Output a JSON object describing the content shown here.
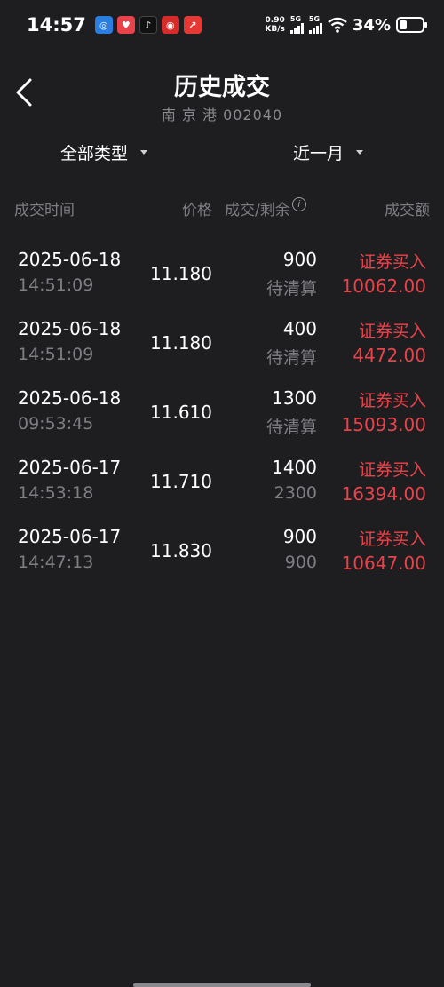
{
  "status_bar": {
    "time": "14:57",
    "net_speed_value": "0.90",
    "net_speed_unit": "KB/s",
    "signal1_label": "5G",
    "signal2_label": "5G",
    "battery": "34%",
    "battery_level": 0.34
  },
  "header": {
    "title": "历史成交",
    "subtitle": "南 京 港 002040"
  },
  "filters": {
    "type": "全部类型",
    "period": "近一月"
  },
  "columns": {
    "time": "成交时间",
    "price": "价格",
    "fill": "成交/剩余",
    "amount": "成交额"
  },
  "trades": [
    {
      "date": "2025-06-18",
      "time": "14:51:09",
      "price": "11.180",
      "qty": "900",
      "remaining": "待清算",
      "type": "证券买入",
      "amount": "10062.00"
    },
    {
      "date": "2025-06-18",
      "time": "14:51:09",
      "price": "11.180",
      "qty": "400",
      "remaining": "待清算",
      "type": "证券买入",
      "amount": "4472.00"
    },
    {
      "date": "2025-06-18",
      "time": "09:53:45",
      "price": "11.610",
      "qty": "1300",
      "remaining": "待清算",
      "type": "证券买入",
      "amount": "15093.00"
    },
    {
      "date": "2025-06-17",
      "time": "14:53:18",
      "price": "11.710",
      "qty": "1400",
      "remaining": "2300",
      "type": "证券买入",
      "amount": "16394.00"
    },
    {
      "date": "2025-06-17",
      "time": "14:47:13",
      "price": "11.830",
      "qty": "900",
      "remaining": "900",
      "type": "证券买入",
      "amount": "10647.00"
    }
  ],
  "colors": {
    "background": "#1e1e21",
    "buy": "#e8434b",
    "muted": "#7e7e83"
  }
}
